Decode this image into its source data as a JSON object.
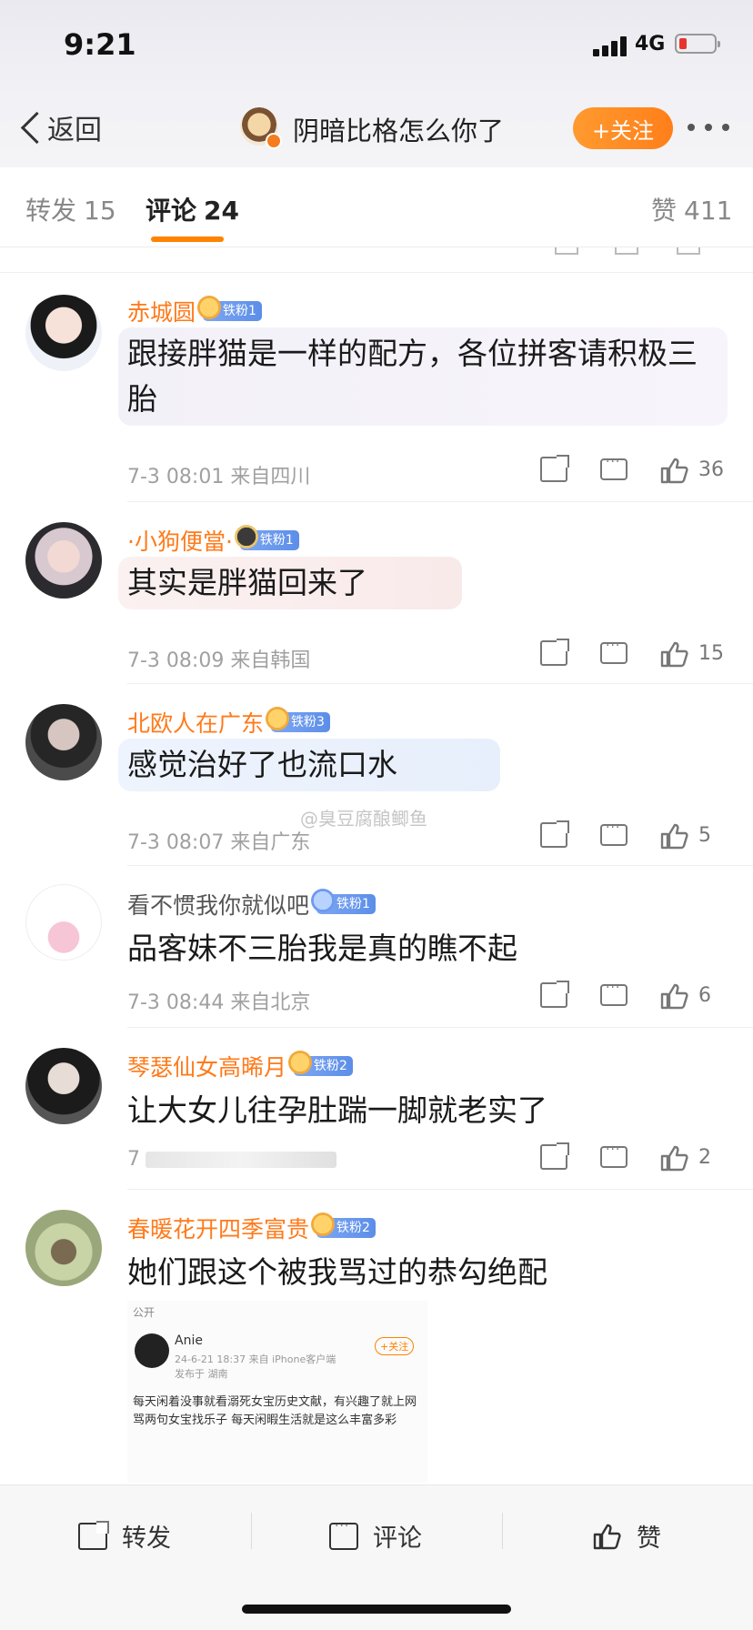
{
  "status_bar": {
    "time": "9:21",
    "network": "4G"
  },
  "header": {
    "back_label": "返回",
    "title": "阴暗比格怎么你了",
    "follow_label": "+关注"
  },
  "tabs": [
    {
      "label": "转发",
      "count": "15"
    },
    {
      "label": "评论",
      "count": "24"
    },
    {
      "label": "赞",
      "count": "411"
    }
  ],
  "watermark": "@臭豆腐酿鲫鱼",
  "comments": [
    {
      "name": "赤城圆",
      "badge": "铁粉1",
      "text": "跟接胖猫是一样的配方，各位拼客请积极三胎",
      "meta": "7-3 08:01 来自四川",
      "likes": "36"
    },
    {
      "name": "·小狗便當·",
      "badge": "铁粉1",
      "text": "其实是胖猫回来了",
      "meta": "7-3 08:09 来自韩国",
      "likes": "15"
    },
    {
      "name": "北欧人在广东",
      "badge": "铁粉3",
      "text": "感觉治好了也流口水",
      "meta": "7-3 08:07 来自广东",
      "likes": "5"
    },
    {
      "name": "看不惯我你就似吧",
      "badge": "铁粉1",
      "text": "品客妹不三胎我是真的瞧不起",
      "meta": "7-3 08:44 来自北京",
      "likes": "6"
    },
    {
      "name": "琴瑟仙女高晞月",
      "badge": "铁粉2",
      "text": "让大女儿往孕肚踹一脚就老实了",
      "meta": "7",
      "likes": "2"
    },
    {
      "name": "春暖花开四季富贵",
      "badge": "铁粉2",
      "text": "她们跟这个被我骂过的恭勾绝配",
      "meta": "",
      "likes": ""
    }
  ],
  "embedded_post": {
    "visibility": "公开",
    "name": "Anie",
    "meta": "24-6-21 18:37 来自 iPhone客户端",
    "location": "发布于 湖南",
    "follow": "+关注",
    "text": "每天闲着没事就看溺死女宝历史文献，有兴趣了就上网骂两句女宝找乐子 每天闲暇生活就是这么丰富多彩"
  },
  "bottom_bar": {
    "repost": "转发",
    "comment": "评论",
    "like": "赞"
  }
}
